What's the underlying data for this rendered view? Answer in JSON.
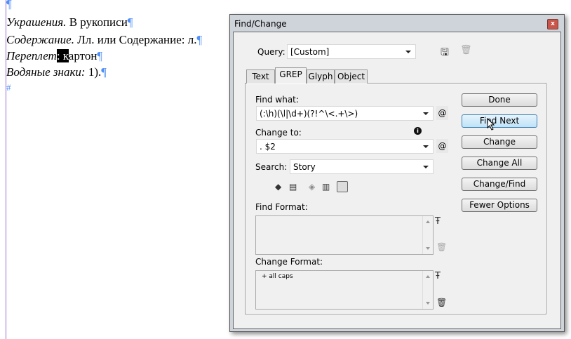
{
  "document": {
    "lines": [
      {
        "italic": "Украшения.",
        "rest": " В рукописи"
      },
      {
        "italic": "Содержание.",
        "rest": " Лл. или Содержание: л."
      },
      {
        "italic": "Переплет",
        "highlight": ": к",
        "rest": "артон"
      },
      {
        "italic": "Водяные знаки:",
        "rest": " 1)."
      }
    ],
    "pilcrow": "¶",
    "end_mark": "#"
  },
  "dialog": {
    "title": "Find/Change",
    "close": "x",
    "query_label": "Query:",
    "query_value": "[Custom]",
    "tabs": [
      "Text",
      "GREP",
      "Glyph",
      "Object"
    ],
    "active_tab": "GREP",
    "find_what_label": "Find what:",
    "find_what_value": "(:\\h)(\\l|\\d+)(?!^\\<.+\\>)",
    "change_to_label": "Change to:",
    "change_to_value": ". $2",
    "search_label": "Search:",
    "search_value": "Story",
    "at": "@",
    "buttons": [
      "Done",
      "Find Next",
      "Change",
      "Change All",
      "Change/Find",
      "Fewer Options"
    ],
    "find_format_label": "Find Format:",
    "find_format_value": "",
    "change_format_label": "Change Format:",
    "change_format_value": "+ all caps",
    "accent": "#3c7fb1"
  }
}
